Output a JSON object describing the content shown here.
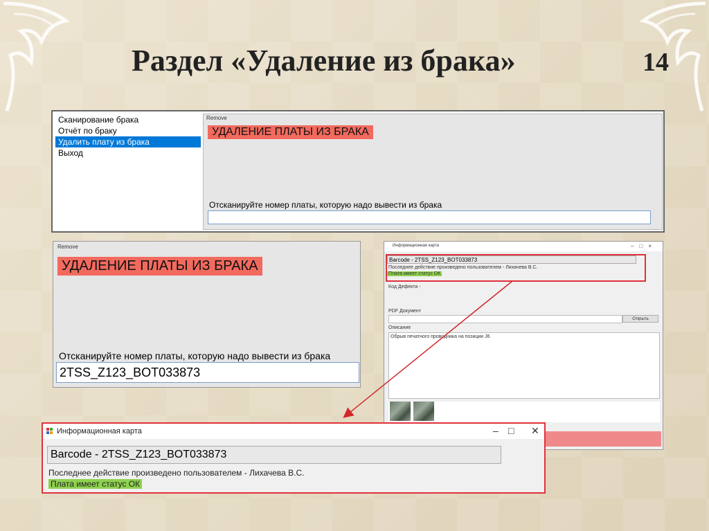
{
  "slide": {
    "title": "Раздел «Удаление из брака»",
    "number": "14"
  },
  "screen1": {
    "menu": [
      "Сканирование брака",
      "Отчёт по браку",
      "Удалить плату из брака",
      "Выход"
    ],
    "selected_index": 2,
    "panel_caption": "Remove",
    "banner": "УДАЛЕНИЕ ПЛАТЫ ИЗ БРАКА",
    "prompt": "Отсканируйте номер платы, которую надо вывести из брака",
    "scan_value": ""
  },
  "screen2": {
    "panel_caption": "Remove",
    "banner": "УДАЛЕНИЕ ПЛАТЫ ИЗ БРАКА",
    "prompt": "Отсканируйте номер платы, которую надо вывести из брака",
    "scan_value": "2TSS_Z123_BOT033873"
  },
  "screen3": {
    "title": "Информационная карта",
    "barcode": "Barcode - 2TSS_Z123_BOT033873",
    "last_action": "Последнее действие произведено пользователем - Лихачева В.С.",
    "status": "Плата имеет статус ОК",
    "defect_code": "Код Дефекта -",
    "pdf_label": "PDF Документ",
    "open_button": "Открыть",
    "desc_label": "Описание",
    "description": "Обрыв печатного проводника на позиции J6"
  },
  "screen4": {
    "title": "Информационная карта",
    "barcode": "Barcode - 2TSS_Z123_BOT033873",
    "last_action": "Последнее действие произведено пользователем - Лихачева В.С.",
    "status": "Плата имеет статус ОК"
  },
  "colors": {
    "banner_red": "#f26a5e",
    "status_green": "#8fd14f",
    "highlight_red": "#e0303a",
    "selection_blue": "#0078d7"
  }
}
